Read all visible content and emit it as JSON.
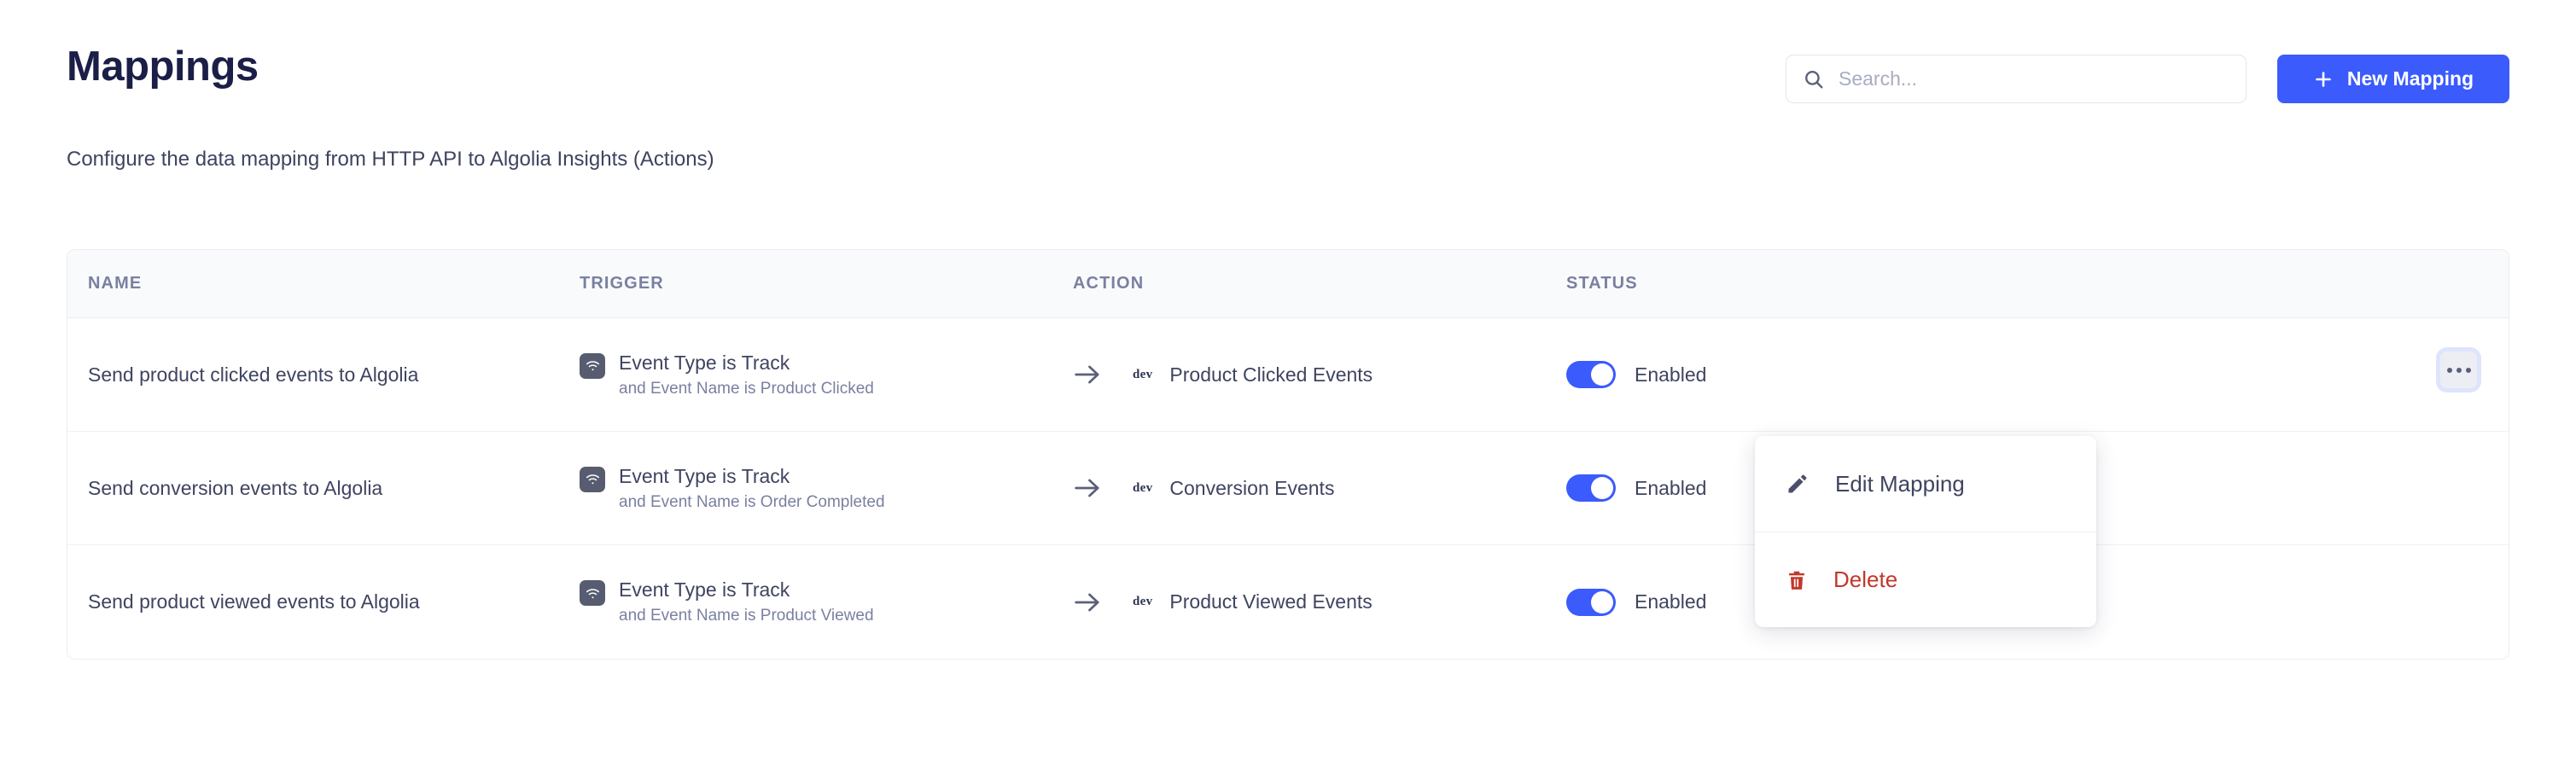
{
  "header": {
    "title": "Mappings",
    "subtitle": "Configure the data mapping from HTTP API to Algolia Insights (Actions)",
    "search": {
      "placeholder": "Search...",
      "value": "",
      "icon": "search-icon"
    },
    "new_mapping_button": {
      "label": "New Mapping",
      "icon": "plus-icon",
      "color": "#3b5bfd"
    }
  },
  "table": {
    "columns": [
      "NAME",
      "TRIGGER",
      "ACTION",
      "STATUS"
    ],
    "rows": [
      {
        "name": "Send product clicked events to Algolia",
        "trigger_icon": "wifi-icon",
        "trigger_main": "Event Type is Track",
        "trigger_sub": "and Event Name is Product Clicked",
        "action_icon": "arrow-right-icon",
        "action_badge": "dev",
        "action_label": "Product Clicked Events",
        "status_enabled": true,
        "status_label": "Enabled",
        "menu_icon": "ellipsis-icon"
      },
      {
        "name": "Send conversion events to Algolia",
        "trigger_icon": "wifi-icon",
        "trigger_main": "Event Type is Track",
        "trigger_sub": "and Event Name is Order Completed",
        "action_icon": "arrow-right-icon",
        "action_badge": "dev",
        "action_label": "Conversion Events",
        "status_enabled": true,
        "status_label": "Enabled",
        "menu_icon": "ellipsis-icon"
      },
      {
        "name": "Send product viewed events to Algolia",
        "trigger_icon": "wifi-icon",
        "trigger_main": "Event Type is Track",
        "trigger_sub": "and Event Name is Product Viewed",
        "action_icon": "arrow-right-icon",
        "action_badge": "dev",
        "action_label": "Product Viewed Events",
        "status_enabled": true,
        "status_label": "Enabled",
        "menu_icon": "ellipsis-icon"
      }
    ]
  },
  "context_menu": {
    "open": true,
    "items": [
      {
        "label": "Edit Mapping",
        "icon": "pencil-icon",
        "color": "#3f4460"
      },
      {
        "label": "Delete",
        "icon": "trash-icon",
        "color": "#c0392b"
      }
    ]
  },
  "colors": {
    "accent": "#3b5bfd",
    "danger": "#c0392b",
    "title": "#1b1f47",
    "muted": "#7a80a0",
    "header_bg": "#f9fafc",
    "border": "#ececf3"
  }
}
